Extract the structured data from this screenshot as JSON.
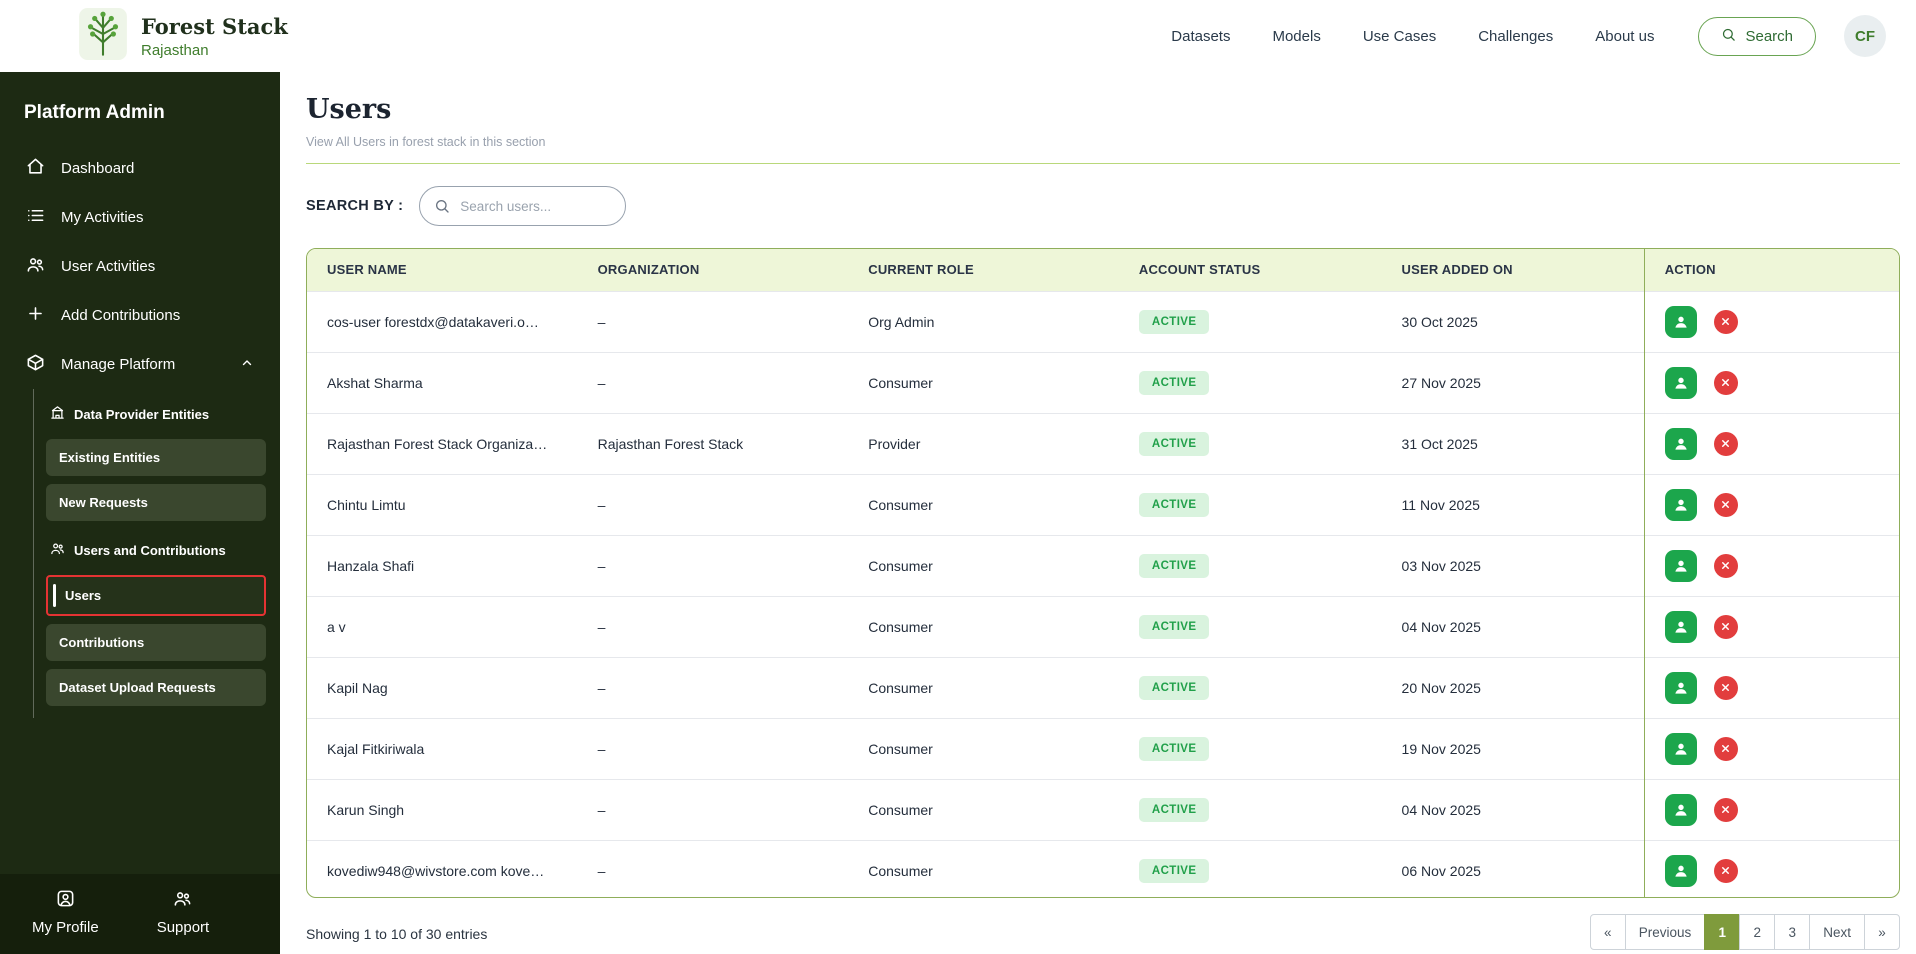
{
  "colors": {
    "sidebar_bg": "#1d2a13",
    "accent_green": "#3f7d2c",
    "table_border": "#8fae5a",
    "active_badge_bg": "#d9f3de",
    "active_badge_text": "#21a04a",
    "selection_outline": "#e53333",
    "pagination_active": "#7f9b3c"
  },
  "topnav": {
    "brand_name": "Forest Stack",
    "brand_region": "Rajasthan",
    "links": [
      {
        "label": "Datasets"
      },
      {
        "label": "Models"
      },
      {
        "label": "Use Cases"
      },
      {
        "label": "Challenges"
      },
      {
        "label": "About us"
      }
    ],
    "search_label": "Search",
    "avatar_initials": "CF"
  },
  "sidebar": {
    "title": "Platform Admin",
    "items": [
      {
        "label": "Dashboard"
      },
      {
        "label": "My Activities"
      },
      {
        "label": "User Activities"
      },
      {
        "label": "Add Contributions"
      },
      {
        "label": "Manage Platform"
      }
    ],
    "sections": [
      {
        "header": "Data Provider Entities",
        "items": [
          "Existing Entities",
          "New Requests"
        ]
      },
      {
        "header": "Users and Contributions",
        "items": [
          "Users",
          "Contributions",
          "Dataset Upload Requests"
        ]
      }
    ],
    "footer": [
      {
        "label": "My Profile"
      },
      {
        "label": "Support"
      }
    ]
  },
  "page": {
    "title": "Users",
    "subtitle": "View All Users in forest stack in this section",
    "search_by": "SEARCH BY :",
    "search_placeholder": "Search users..."
  },
  "table": {
    "headers": [
      "USER NAME",
      "ORGANIZATION",
      "CURRENT ROLE",
      "ACCOUNT STATUS",
      "USER ADDED ON",
      "ACTION"
    ],
    "rows": [
      {
        "name": "cos-user forestdx@datakaveri.o…",
        "org": "–",
        "role": "Org Admin",
        "status": "ACTIVE",
        "added": "30 Oct 2025"
      },
      {
        "name": "Akshat Sharma",
        "org": "–",
        "role": "Consumer",
        "status": "ACTIVE",
        "added": "27 Nov 2025"
      },
      {
        "name": "Rajasthan Forest Stack Organiza…",
        "org": "Rajasthan Forest Stack",
        "role": "Provider",
        "status": "ACTIVE",
        "added": "31 Oct 2025"
      },
      {
        "name": "Chintu Limtu",
        "org": "–",
        "role": "Consumer",
        "status": "ACTIVE",
        "added": "11 Nov 2025"
      },
      {
        "name": "Hanzala Shafi",
        "org": "–",
        "role": "Consumer",
        "status": "ACTIVE",
        "added": "03 Nov 2025"
      },
      {
        "name": "a v",
        "org": "–",
        "role": "Consumer",
        "status": "ACTIVE",
        "added": "04 Nov 2025"
      },
      {
        "name": "Kapil Nag",
        "org": "–",
        "role": "Consumer",
        "status": "ACTIVE",
        "added": "20 Nov 2025"
      },
      {
        "name": "Kajal Fitkiriwala",
        "org": "–",
        "role": "Consumer",
        "status": "ACTIVE",
        "added": "19 Nov 2025"
      },
      {
        "name": "Karun Singh",
        "org": "–",
        "role": "Consumer",
        "status": "ACTIVE",
        "added": "04 Nov 2025"
      },
      {
        "name": "kovediw948@wivstore.com kove…",
        "org": "–",
        "role": "Consumer",
        "status": "ACTIVE",
        "added": "06 Nov 2025"
      }
    ]
  },
  "footerbar": {
    "showing": "Showing 1 to 10 of 30 entries",
    "pagination": {
      "first": "«",
      "previous": "Previous",
      "pages": [
        "1",
        "2",
        "3"
      ],
      "active_page": "1",
      "next": "Next",
      "last": "»"
    }
  }
}
